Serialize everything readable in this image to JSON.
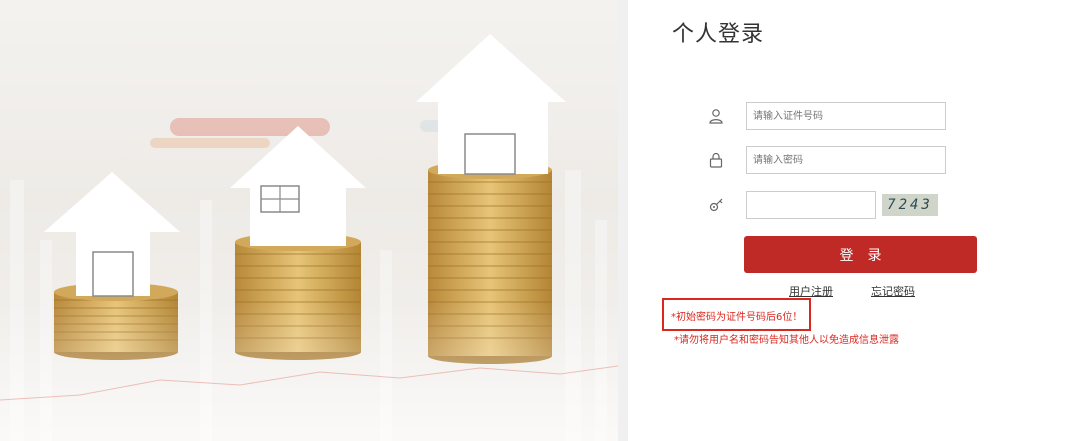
{
  "panel": {
    "title": "个人登录",
    "fields": {
      "id_placeholder": "请输入证件号码",
      "password_placeholder": "请输入密码",
      "captcha_value": "",
      "captcha_code": "7243"
    },
    "login_label": "登录",
    "register_label": "用户注册",
    "forgot_label": "忘记密码",
    "notice_initial_password": "*初始密码为证件号码后6位！",
    "notice_privacy": "*请勿将用户名和密码告知其他人以免造成信息泄露"
  },
  "colors": {
    "accent": "#bf2a26",
    "warning": "#d9281f"
  },
  "icons": {
    "user": "user-icon",
    "lock": "lock-icon",
    "captcha": "key-icon"
  }
}
